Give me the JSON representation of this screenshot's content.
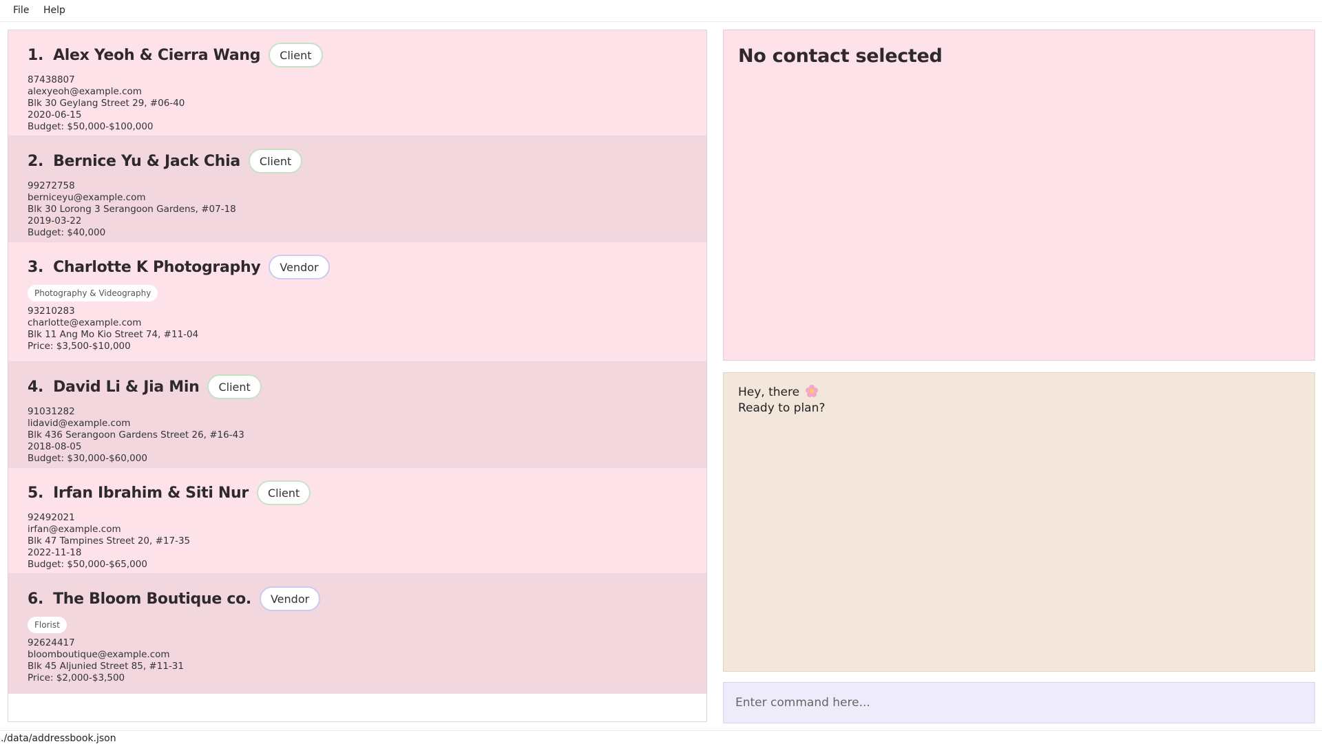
{
  "menu": {
    "file": "File",
    "help": "Help"
  },
  "contacts": [
    {
      "index": "1.",
      "name": "Alex Yeoh & Cierra Wang",
      "role": "Client",
      "tag": null,
      "phone": "87438807",
      "email": "alexyeoh@example.com",
      "address": "Blk 30 Geylang Street 29, #06-40",
      "date": "2020-06-15",
      "money": "Budget: $50,000-$100,000"
    },
    {
      "index": "2.",
      "name": "Bernice Yu & Jack Chia",
      "role": "Client",
      "tag": null,
      "phone": "99272758",
      "email": "berniceyu@example.com",
      "address": "Blk 30 Lorong 3 Serangoon Gardens, #07-18",
      "date": "2019-03-22",
      "money": "Budget: $40,000"
    },
    {
      "index": "3.",
      "name": "Charlotte K Photography",
      "role": "Vendor",
      "tag": "Photography & Videography",
      "phone": "93210283",
      "email": "charlotte@example.com",
      "address": "Blk 11 Ang Mo Kio Street 74, #11-04",
      "date": null,
      "money": "Price: $3,500-$10,000"
    },
    {
      "index": "4.",
      "name": "David Li & Jia Min",
      "role": "Client",
      "tag": null,
      "phone": "91031282",
      "email": "lidavid@example.com",
      "address": "Blk 436 Serangoon Gardens Street 26, #16-43",
      "date": "2018-08-05",
      "money": "Budget: $30,000-$60,000"
    },
    {
      "index": "5.",
      "name": "Irfan Ibrahim & Siti Nur",
      "role": "Client",
      "tag": null,
      "phone": "92492021",
      "email": "irfan@example.com",
      "address": "Blk 47 Tampines Street 20, #17-35",
      "date": "2022-11-18",
      "money": "Budget: $50,000-$65,000"
    },
    {
      "index": "6.",
      "name": "The Bloom Boutique co.",
      "role": "Vendor",
      "tag": "Florist",
      "phone": "92624417",
      "email": "bloomboutique@example.com",
      "address": "Blk 45 Aljunied Street 85, #11-31",
      "date": null,
      "money": "Price: $2,000-$3,500"
    }
  ],
  "detail": {
    "title": "No contact selected"
  },
  "result": {
    "line1": "Hey, there",
    "line2": "Ready to plan?",
    "icon": "flower-icon"
  },
  "command": {
    "placeholder": "Enter command here..."
  },
  "status": {
    "path": "./data/addressbook.json"
  },
  "colors": {
    "card_odd": "#fde2e9",
    "card_even": "#f2d7de",
    "result_bg": "#f3e6da",
    "command_bg": "#eeecfb",
    "client_border": "#c8e0c6",
    "vendor_border": "#c8ccf0"
  }
}
